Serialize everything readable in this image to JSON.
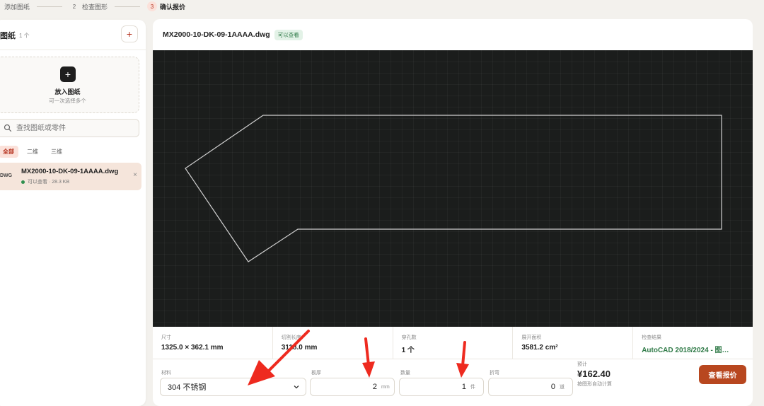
{
  "steps": [
    {
      "num": "",
      "label": "添加图纸"
    },
    {
      "num": "2",
      "label": "检查图形"
    },
    {
      "num": "3",
      "label": "确认报价"
    }
  ],
  "sidebar": {
    "title": "图纸",
    "count": "1 个",
    "add_label": "+",
    "dropzone": {
      "icon": "+",
      "title": "放入图纸",
      "subtitle": "可一次选择多个"
    },
    "search": {
      "placeholder": "查找图纸或零件",
      "icon": "search-icon"
    },
    "filters": [
      "全部",
      "二维",
      "三维"
    ],
    "active_filter": "全部",
    "files": [
      {
        "type": "DWG",
        "name": "MX2000-10-DK-09-1AAAA.dwg",
        "meta": "可以查看 · 28.3 KB",
        "close": "×"
      }
    ]
  },
  "viewer": {
    "file_name": "MX2000-10-DK-09-1AAAA.dwg",
    "badge": "可以查看"
  },
  "stats": [
    {
      "label": "尺寸",
      "value": "1325.0 × 362.1 mm"
    },
    {
      "label": "切割长度",
      "value": "3118.0 mm"
    },
    {
      "label": "穿孔数",
      "value": "1 个"
    },
    {
      "label": "展开面积",
      "value": "3581.2 cm²"
    },
    {
      "label": "检查结果",
      "value": "AutoCAD 2018/2024 - 图…"
    }
  ],
  "form": {
    "material": {
      "label": "材料",
      "value": "304 不锈钢"
    },
    "thickness": {
      "label": "板厚",
      "value": "2",
      "unit": "mm"
    },
    "quantity": {
      "label": "数量",
      "value": "1",
      "unit": "件"
    },
    "bends": {
      "label": "折弯",
      "value": "0",
      "unit": "道"
    },
    "estimate": {
      "label": "预计",
      "value": "¥162.40",
      "note": "按图形自动计算"
    },
    "submit_label": "查看报价"
  },
  "colors": {
    "accent": "#b8471f",
    "canvas_bg": "#1b1d1c",
    "success": "#2f7a47",
    "annotation": "#ee2a1f"
  }
}
